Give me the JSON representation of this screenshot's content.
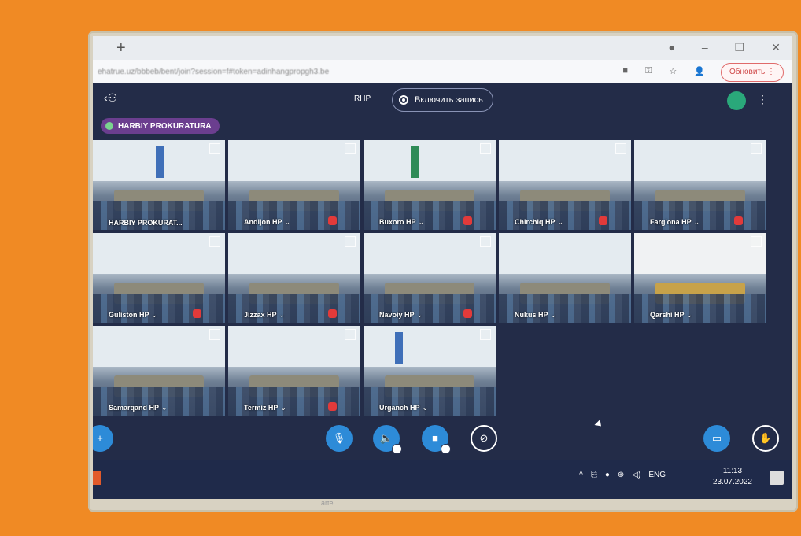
{
  "browser": {
    "url": "ehatrue.uz/bbbeb/bent/join?session=f#token=adinhangpropgh3.be",
    "update_label": "Обновить"
  },
  "app": {
    "presenter_label": "RHP",
    "record_label": "Включить запись",
    "room_name": "HARBIY PROKURATURA"
  },
  "tiles": [
    {
      "label": "HARBIY PROKURAT..."
    },
    {
      "label": "Andijon HP"
    },
    {
      "label": "Buxoro HP"
    },
    {
      "label": "Chirchiq HP"
    },
    {
      "label": "Farg'ona HP"
    },
    {
      "label": "Guliston HP"
    },
    {
      "label": "Jizzax HP"
    },
    {
      "label": "Navoiy HP"
    },
    {
      "label": "Nukus HP"
    },
    {
      "label": "Qarshi HP"
    },
    {
      "label": "Samarqand HP"
    },
    {
      "label": "Termiz HP"
    },
    {
      "label": "Urganch HP"
    }
  ],
  "taskbar": {
    "language": "ENG",
    "time": "11:13",
    "date": "23.07.2022"
  },
  "monitor_brand": "artel",
  "icons": {
    "add": "plus-icon",
    "mic": "microphone-icon",
    "audio": "speaker-icon",
    "camera": "camera-icon",
    "screen_share_off": "screen-share-off-icon",
    "present": "monitor-icon",
    "raise_hand": "hand-icon"
  }
}
